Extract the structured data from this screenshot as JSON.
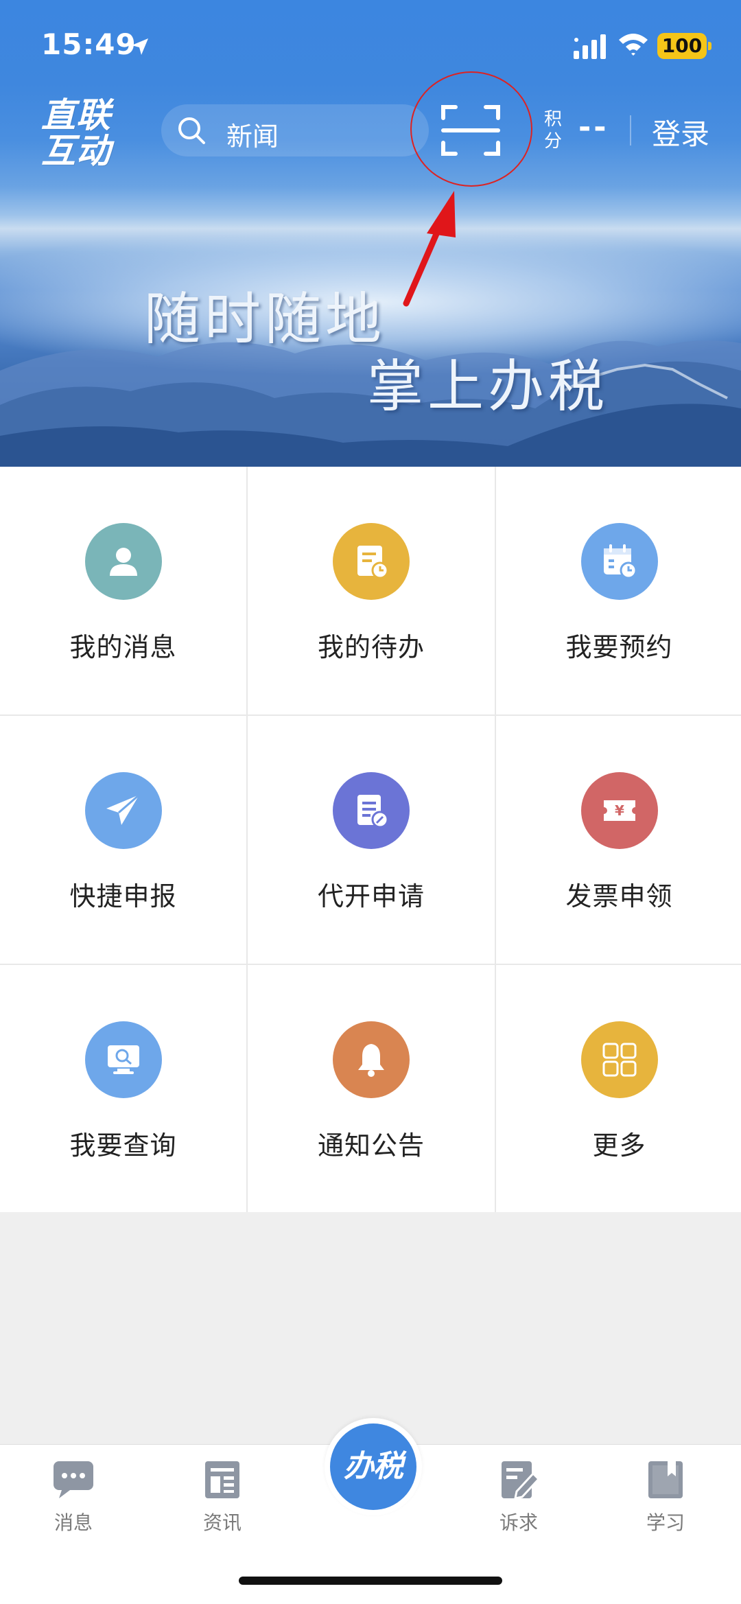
{
  "status_bar": {
    "time": "15:49",
    "battery": "100"
  },
  "header": {
    "logo_line1": "直联",
    "logo_line2": "互动",
    "search_placeholder": "新闻",
    "points_label": "积分",
    "points_value": "--",
    "login_label": "登录"
  },
  "banner": {
    "slogan_line1": "随时随地",
    "slogan_line2": "掌上办税"
  },
  "grid": [
    {
      "label": "我的消息",
      "icon": "user-icon",
      "color": "#7ab5b8"
    },
    {
      "label": "我的待办",
      "icon": "todo-icon",
      "color": "#e7b43d"
    },
    {
      "label": "我要预约",
      "icon": "calendar-clock-icon",
      "color": "#6ea7ea"
    },
    {
      "label": "快捷申报",
      "icon": "paper-plane-icon",
      "color": "#6ea7ea"
    },
    {
      "label": "代开申请",
      "icon": "document-edit-icon",
      "color": "#6b74d6"
    },
    {
      "label": "发票申领",
      "icon": "invoice-yen-icon",
      "color": "#d16666"
    },
    {
      "label": "我要查询",
      "icon": "monitor-search-icon",
      "color": "#6ea7ea"
    },
    {
      "label": "通知公告",
      "icon": "bell-icon",
      "color": "#d98551"
    },
    {
      "label": "更多",
      "icon": "grid-more-icon",
      "color": "#e7b43d"
    }
  ],
  "tabbar": {
    "messages": "消息",
    "news": "资讯",
    "center": "办税",
    "appeals": "诉求",
    "learning": "学习"
  }
}
